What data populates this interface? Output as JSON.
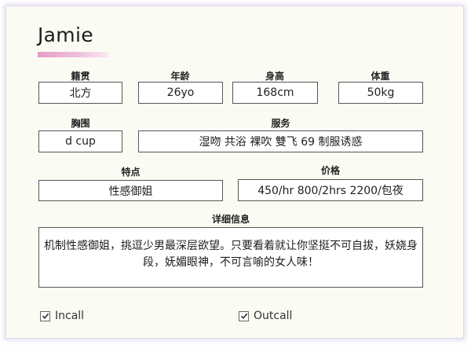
{
  "profile": {
    "name": "Jamie",
    "accent_color": "#e59ec9",
    "fields": {
      "origin": {
        "label": "籍贯",
        "value": "北方"
      },
      "age": {
        "label": "年龄",
        "value": "26yo"
      },
      "height": {
        "label": "身高",
        "value": "168cm"
      },
      "weight": {
        "label": "体重",
        "value": "50kg"
      },
      "chest": {
        "label": "胸围",
        "value": "d cup"
      },
      "services": {
        "label": "服务",
        "value": "湿吻 共浴 裸吹 雙飞 69 制服诱惑"
      },
      "traits": {
        "label": "特点",
        "value": "性感御姐"
      },
      "price": {
        "label": "价格",
        "value": "450/hr  800/2hrs  2200/包夜"
      },
      "details": {
        "label": "详细信息",
        "value": "机制性感御姐，挑逗少男最深层欲望。只要看着就让你坚挺不可自拔，妖娆身段，妩媚眼神，不可言喻的女人味！"
      }
    },
    "options": {
      "incall": {
        "label": "Incall",
        "checked": true
      },
      "outcall": {
        "label": "Outcall",
        "checked": true
      }
    }
  }
}
